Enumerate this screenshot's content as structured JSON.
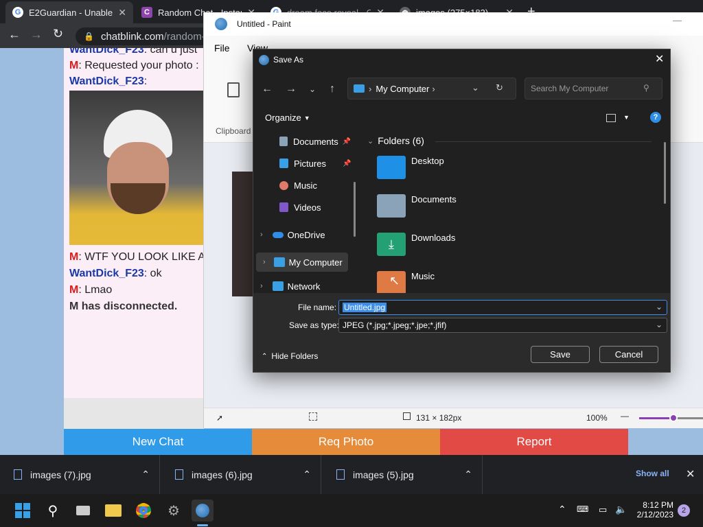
{
  "browser": {
    "tabs": [
      {
        "title": "E2Guardian - Unable to",
        "favicon": "G"
      },
      {
        "title": "Random Chat - Instant",
        "favicon": "C"
      },
      {
        "title": "dream face reveal - Go",
        "favicon": "G"
      },
      {
        "title": "images (275×183)",
        "favicon": "globe"
      }
    ],
    "url_host": "chatblink.com",
    "url_path": "/random-c"
  },
  "chat": {
    "lines": [
      {
        "who": "WantDick_F23",
        "text": ": can u just"
      },
      {
        "who": "M",
        "text": ": Requested your photo :"
      },
      {
        "who": "WantDick_F23",
        "text": ":"
      },
      {
        "who": "M",
        "text": ": WTF YOU LOOK LIKE A"
      },
      {
        "who": "WantDick_F23",
        "text": ": ok"
      },
      {
        "who": "M",
        "text": ": Lmao"
      }
    ],
    "disconnect": "M has disconnected.",
    "buttons": {
      "new_chat": "New Chat",
      "req_photo": "Req Photo",
      "report": "Report"
    },
    "colors": {
      "new_chat": "#2f9be9",
      "req_photo": "#e58b39",
      "report": "#e24a45"
    }
  },
  "paint": {
    "title": "Untitled - Paint",
    "menu": {
      "file": "File",
      "view": "View"
    },
    "ribbon": {
      "clipboard": "Clipboard"
    },
    "status": {
      "dimensions": "131 × 182px",
      "zoom": "100%"
    }
  },
  "dialog": {
    "title": "Save As",
    "address": "My Computer",
    "search_placeholder": "Search My Computer",
    "organize": "Organize",
    "nav": [
      {
        "label": "Documents",
        "icon": "documents-icon",
        "pinned": true
      },
      {
        "label": "Pictures",
        "icon": "pictures-icon",
        "pinned": true
      },
      {
        "label": "Music",
        "icon": "music-icon",
        "pinned": false
      },
      {
        "label": "Videos",
        "icon": "videos-icon",
        "pinned": false
      },
      {
        "label": "OneDrive",
        "icon": "onedrive-icon",
        "pinned": false
      },
      {
        "label": "My Computer",
        "icon": "computer-icon",
        "pinned": false
      },
      {
        "label": "Network",
        "icon": "network-icon",
        "pinned": false
      }
    ],
    "folders_header": "Folders (6)",
    "folders": [
      {
        "label": "Desktop",
        "color": "#1e90e6"
      },
      {
        "label": "Documents",
        "color": "#8aa3b8"
      },
      {
        "label": "Downloads",
        "color": "#23a074"
      },
      {
        "label": "Music",
        "color": "#e07a44"
      }
    ],
    "file_name_label": "File name:",
    "file_name": "Untitled.jpg",
    "save_type_label": "Save as type:",
    "save_type": "JPEG (*.jpg;*.jpeg;*.jpe;*.jfif)",
    "hide_folders": "Hide Folders",
    "save": "Save",
    "cancel": "Cancel"
  },
  "downloads": {
    "items": [
      "images (7).jpg",
      "images (6).jpg",
      "images (5).jpg"
    ],
    "show_all": "Show all"
  },
  "taskbar": {
    "time": "8:12 PM",
    "date": "2/12/2023",
    "notifications": "2"
  }
}
